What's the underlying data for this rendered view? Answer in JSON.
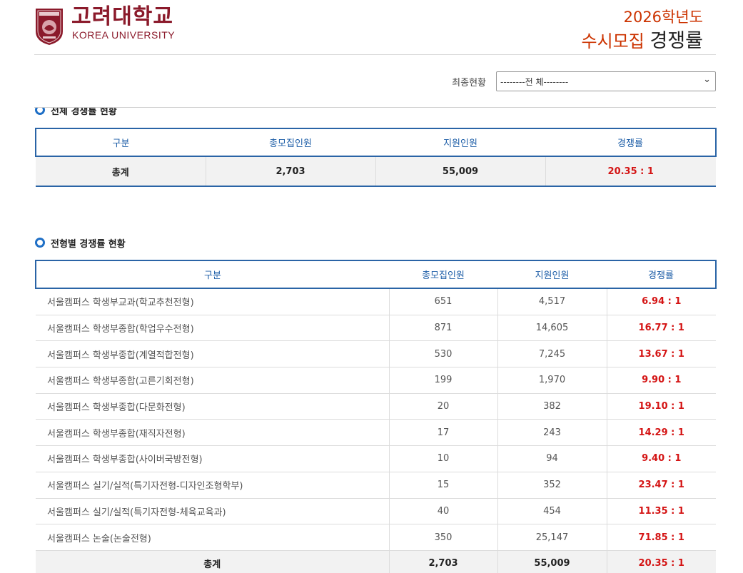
{
  "header": {
    "logo_ko": "고려대학교",
    "logo_en": "KOREA UNIVERSITY",
    "year": "2026학년도",
    "title_a": "수시모집",
    "title_b": "경쟁률"
  },
  "filter": {
    "label": "최종현황",
    "selected": "--------전 체--------"
  },
  "overall": {
    "title": "전체 경쟁률 현황",
    "headers": [
      "구분",
      "총모집인원",
      "지원인원",
      "경쟁률"
    ],
    "total": [
      "총계",
      "2,703",
      "55,009",
      "20.35 : 1"
    ]
  },
  "by_type": {
    "title": "전형별 경쟁률 현황",
    "headers": [
      "구분",
      "총모집인원",
      "지원인원",
      "경쟁률"
    ],
    "rows": [
      [
        "서울캠퍼스 학생부교과(학교추천전형)",
        "651",
        "4,517",
        "6.94 : 1"
      ],
      [
        "서울캠퍼스 학생부종합(학업우수전형)",
        "871",
        "14,605",
        "16.77 : 1"
      ],
      [
        "서울캠퍼스 학생부종합(계열적합전형)",
        "530",
        "7,245",
        "13.67 : 1"
      ],
      [
        "서울캠퍼스 학생부종합(고른기회전형)",
        "199",
        "1,970",
        "9.90 : 1"
      ],
      [
        "서울캠퍼스 학생부종합(다문화전형)",
        "20",
        "382",
        "19.10 : 1"
      ],
      [
        "서울캠퍼스 학생부종합(재직자전형)",
        "17",
        "243",
        "14.29 : 1"
      ],
      [
        "서울캠퍼스 학생부종합(사이버국방전형)",
        "10",
        "94",
        "9.40 : 1"
      ],
      [
        "서울캠퍼스 실기/실적(특기자전형-디자인조형학부)",
        "15",
        "352",
        "23.47 : 1"
      ],
      [
        "서울캠퍼스 실기/실적(특기자전형-체육교육과)",
        "40",
        "454",
        "11.35 : 1"
      ],
      [
        "서울캠퍼스 논술(논술전형)",
        "350",
        "25,147",
        "71.85 : 1"
      ]
    ],
    "total": [
      "총계",
      "2,703",
      "55,009",
      "20.35 : 1"
    ]
  },
  "colors": {
    "brand": "#8b1a2b",
    "accent": "#cc3300",
    "table_border": "#2a64a6",
    "rate": "#d41414"
  }
}
